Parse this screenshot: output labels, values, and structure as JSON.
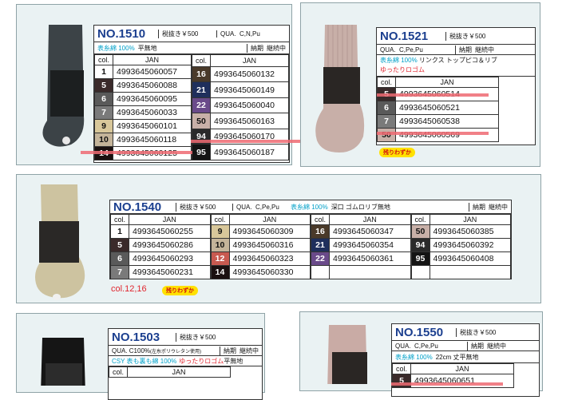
{
  "colors": {
    "5": "#3a2a2a",
    "6": "#5a5a5a",
    "7": "#7a7a7a",
    "9": "#d8c79a",
    "10": "#c4b49a",
    "12": "#c85a50",
    "14": "#1a1010",
    "16": "#4a3a2a",
    "21": "#1f2f5c",
    "22": "#6a4a8a",
    "50": "#c8b0a8",
    "94": "#2a2a2a",
    "95": "#141414",
    "1": "#ffffff"
  },
  "p1510": {
    "no": "NO.1510",
    "price": "税抜き￥500",
    "qua": "QUA.",
    "qua_v": "C,N,Pu",
    "material": "表糸綿 100%",
    "desc": "平無地",
    "delivery": "納期",
    "status": "継続中",
    "col": "col.",
    "jan": "JAN",
    "left": [
      {
        "c": "1",
        "j": "4993645060057"
      },
      {
        "c": "5",
        "j": "4993645060088"
      },
      {
        "c": "6",
        "j": "4993645060095"
      },
      {
        "c": "7",
        "j": "4993645060033"
      },
      {
        "c": "9",
        "j": "4993645060101"
      },
      {
        "c": "10",
        "j": "4993645060118"
      },
      {
        "c": "14",
        "j": "4993645060125"
      }
    ],
    "right": [
      {
        "c": "16",
        "j": "4993645060132"
      },
      {
        "c": "21",
        "j": "4993645060149"
      },
      {
        "c": "22",
        "j": "4993645060040"
      },
      {
        "c": "50",
        "j": "4993645060163"
      },
      {
        "c": "94",
        "j": "4993645060170"
      },
      {
        "c": "95",
        "j": "4993645060187"
      }
    ]
  },
  "p1521": {
    "no": "NO.1521",
    "price": "税抜き￥500",
    "qua": "QUA.",
    "qua_v": "C,Pe,Pu",
    "material": "表糸綿 100%",
    "desc": "リンクス トップピコ＆リブ",
    "desc2": "ゆったりロゴム",
    "delivery": "納期",
    "status": "継続中",
    "col": "col.",
    "jan": "JAN",
    "rows": [
      {
        "c": "5",
        "j": "4993645060514"
      },
      {
        "c": "6",
        "j": "4993645060521"
      },
      {
        "c": "7",
        "j": "4993645060538"
      },
      {
        "c": "50",
        "j": "4993645060569"
      }
    ],
    "tag": "残りわずか"
  },
  "p1540": {
    "no": "NO.1540",
    "price": "税抜き￥500",
    "qua": "QUA.",
    "qua_v": "C,Pe,Pu",
    "material": "表糸綿 100%",
    "desc": "深口 ゴムロリブ無地",
    "delivery": "納期",
    "status": "継続中",
    "col": "col.",
    "jan": "JAN",
    "g1": [
      {
        "c": "1",
        "j": "4993645060255"
      },
      {
        "c": "5",
        "j": "4993645060286"
      },
      {
        "c": "6",
        "j": "4993645060293"
      },
      {
        "c": "7",
        "j": "4993645060231"
      }
    ],
    "g2": [
      {
        "c": "9",
        "j": "4993645060309"
      },
      {
        "c": "10",
        "j": "4993645060316"
      },
      {
        "c": "12",
        "j": "4993645060323"
      },
      {
        "c": "14",
        "j": "4993645060330"
      }
    ],
    "g3": [
      {
        "c": "16",
        "j": "4993645060347"
      },
      {
        "c": "21",
        "j": "4993645060354"
      },
      {
        "c": "22",
        "j": "4993645060361"
      },
      {
        "c": "",
        "j": ""
      }
    ],
    "g4": [
      {
        "c": "50",
        "j": "4993645060385"
      },
      {
        "c": "94",
        "j": "4993645060392"
      },
      {
        "c": "95",
        "j": "4993645060408"
      },
      {
        "c": "",
        "j": ""
      }
    ],
    "note": "col.12,16",
    "tag": "残りわずか"
  },
  "p1503": {
    "no": "NO.1503",
    "price": "税抜き￥500",
    "qua": "QUA. C100%",
    "qua_note": "(左糸ポリウレタン使用)",
    "delivery": "納期",
    "status": "継続中",
    "material": "CSY 表も裏も綿 100%",
    "desc_red": "ゆったりロゴム",
    "desc": "平無地",
    "col": "col.",
    "jan": "JAN"
  },
  "p1550": {
    "no": "NO.1550",
    "price": "税抜き￥500",
    "qua": "QUA.",
    "qua_v": "C,Pe,Pu",
    "delivery": "納期",
    "status": "継続中",
    "material": "表糸綿 100%",
    "desc": "22cm 丈平無地",
    "col": "col.",
    "jan": "JAN",
    "row_c": "5",
    "row_j": "4993645060651"
  }
}
